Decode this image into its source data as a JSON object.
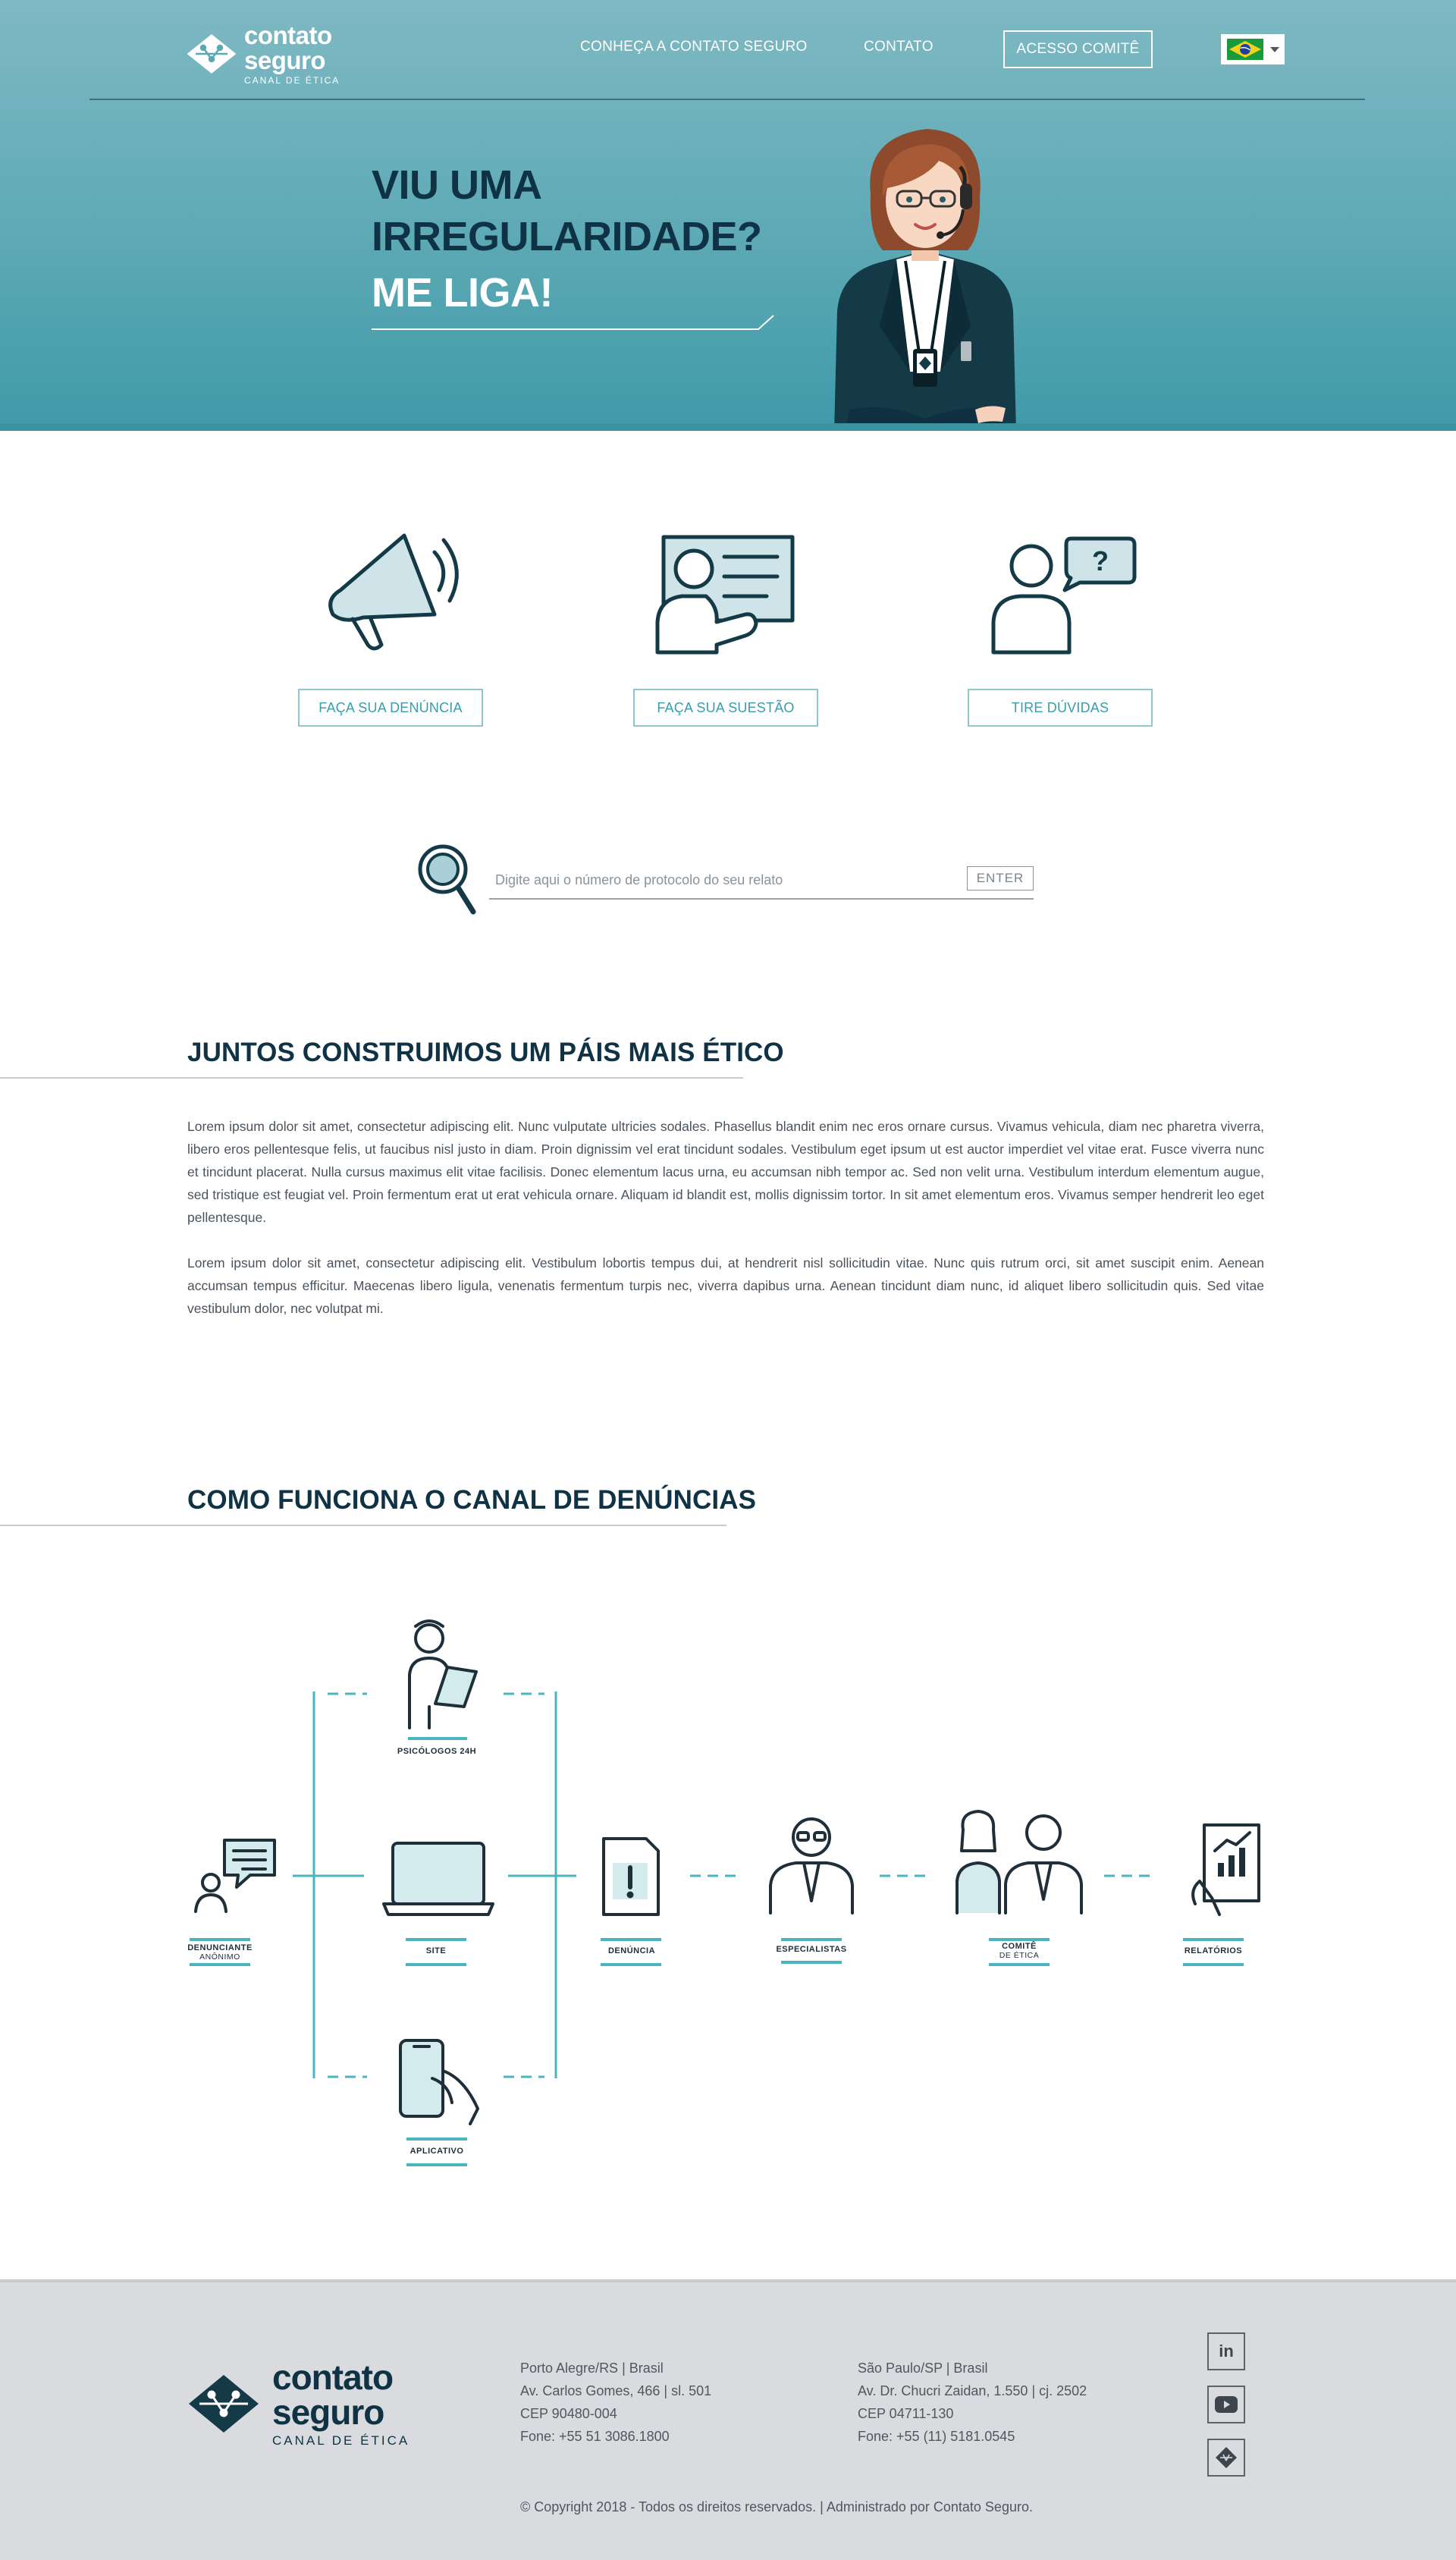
{
  "brand": {
    "logo_line1": "contato",
    "logo_line2": "seguro",
    "logo_line3": "CANAL DE ÉTICA"
  },
  "nav": {
    "about": "CONHEÇA A CONTATO SEGURO",
    "contact": "CONTATO",
    "committee": "ACESSO COMITÊ",
    "language_flag": "brazil-flag-icon"
  },
  "hero": {
    "line1": "VIU UMA",
    "line2": "IRREGULARIDADE?",
    "line3": "ME LIGA!"
  },
  "services": [
    {
      "icon": "megaphone-icon",
      "label": "FAÇA SUA DENÚNCIA"
    },
    {
      "icon": "presentation-board-icon",
      "label": "FAÇA SUA SUESTÃO"
    },
    {
      "icon": "question-bubble-icon",
      "label": "TIRE DÚVIDAS"
    }
  ],
  "search": {
    "placeholder": "Digite aqui o número de protocolo do seu relato",
    "button": "ENTER"
  },
  "about": {
    "title": "JUNTOS CONSTRUIMOS UM PÁIS MAIS ÉTICO",
    "paragraph1": "Lorem ipsum dolor sit amet, consectetur adipiscing elit. Nunc vulputate ultricies sodales. Phasellus blandit enim nec eros ornare cursus. Vivamus vehicula, diam nec pharetra viverra, libero eros pellentesque felis, ut faucibus nisl justo in diam. Proin dignissim vel erat tincidunt sodales. Vestibulum eget ipsum ut est auctor imperdiet vel vitae erat. Fusce viverra nunc et tincidunt placerat. Nulla cursus maximus elit vitae facilisis. Donec elementum lacus urna, eu accumsan nibh tempor ac. Sed non velit urna. Vestibulum interdum elementum augue, sed tristique est feugiat vel. Proin fermentum erat ut erat vehicula ornare. Aliquam id blandit est, mollis dignissim tortor. In sit amet elementum eros. Vivamus semper hendrerit leo eget pellentesque.",
    "paragraph2": "Lorem ipsum dolor sit amet, consectetur adipiscing elit. Vestibulum lobortis tempus dui, at hendrerit nisl sollicitudin vitae. Nunc quis rutrum orci, sit amet suscipit enim. Aenean accumsan tempus efficitur. Maecenas libero ligula, venenatis fermentum turpis nec, viverra dapibus urna. Aenean tincidunt diam nunc, id aliquet libero sollicitudin quis. Sed vitae vestibulum dolor, nec volutpat mi."
  },
  "how_it_works": {
    "title": "COMO FUNCIONA O CANAL DE DENÚNCIAS",
    "steps": {
      "psychologists": "PSICÓLOGOS 24H",
      "whistleblower": "DENUNCIANTE",
      "whistleblower_sub": "ANÔNIMO",
      "site": "SITE",
      "app": "APLICATIVO",
      "report": "DENÚNCIA",
      "specialists": "ESPECIALISTAS",
      "committee": "COMITÊ",
      "committee_sub": "DE ÉTICA",
      "reports": "RELATÓRIOS"
    },
    "accent_color": "#4bb5bf"
  },
  "footer": {
    "office1": {
      "city": "Porto Alegre/RS | Brasil",
      "street": "Av. Carlos Gomes, 466 | sl. 501",
      "zip": "CEP 90480-004",
      "phone": "Fone: +55 51 3086.1800"
    },
    "office2": {
      "city": "São Paulo/SP | Brasil",
      "street": "Av. Dr. Chucri Zaidan, 1.550 | cj. 2502",
      "zip": "CEP 04711-130",
      "phone": "Fone: +55 (11) 5181.0545"
    },
    "social": {
      "linkedin": "in",
      "youtube": "youtube-icon",
      "brand": "contato-seguro-icon"
    },
    "copyright": "© Copyright 2018 - Todos os direitos reservados. | Administrado por Contato Seguro."
  },
  "colors": {
    "hero_bg": "#5aa8b4",
    "navy": "#0f3344",
    "accent": "#3a9cad",
    "footer_bg": "#d9dbde"
  }
}
